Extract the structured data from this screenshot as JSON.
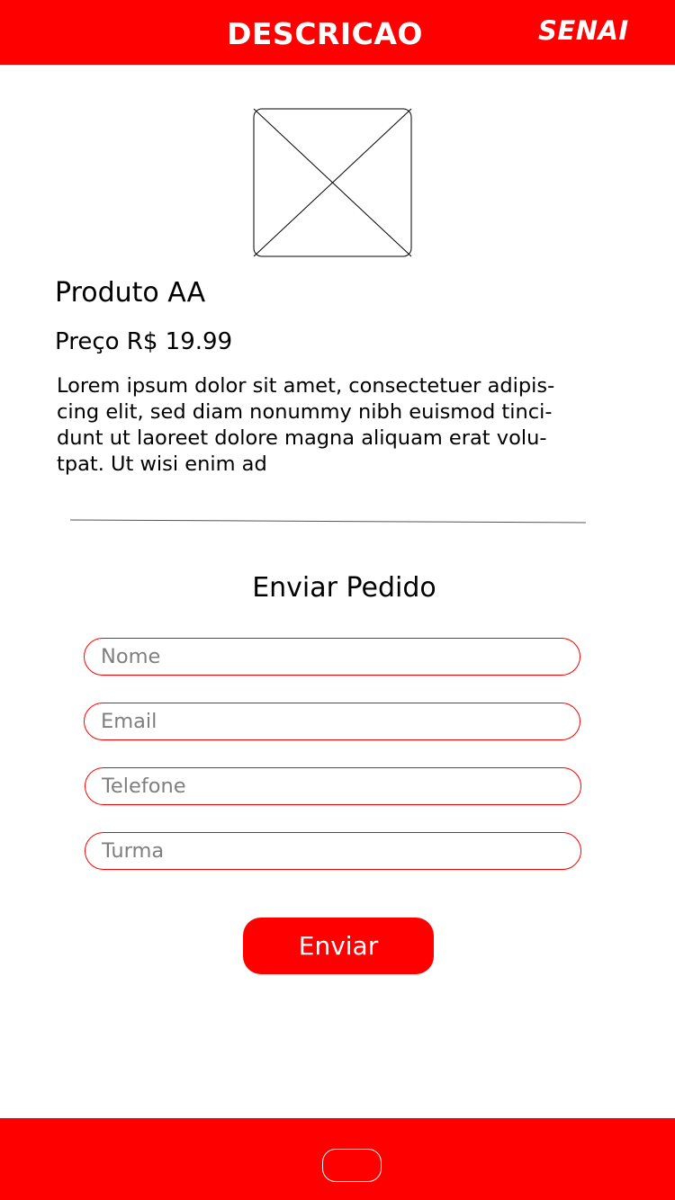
{
  "header": {
    "title": "DESCRICAO",
    "logo": "SENAI",
    "background_color": "#ff0000"
  },
  "product": {
    "image_icon": "image-placeholder-icon",
    "name": "Produto AA",
    "price": "Preço R$ 19.99",
    "description": "Lorem ipsum dolor sit amet, consectetuer adipis-\ncing elit, sed diam nonummy nibh euismod tinci-\ndunt ut laoreet dolore magna aliquam erat volu-\ntpat. Ut wisi enim ad"
  },
  "order_form": {
    "title": "Enviar Pedido",
    "fields": {
      "nome": {
        "placeholder": "Nome",
        "value": ""
      },
      "email": {
        "placeholder": "Email",
        "value": ""
      },
      "telefone": {
        "placeholder": "Telefone",
        "value": ""
      },
      "turma": {
        "placeholder": "Turma",
        "value": ""
      }
    },
    "submit_label": "Enviar",
    "accent_color": "#ff0000"
  },
  "bottom_bar": {
    "home_icon": "home-button-icon"
  }
}
